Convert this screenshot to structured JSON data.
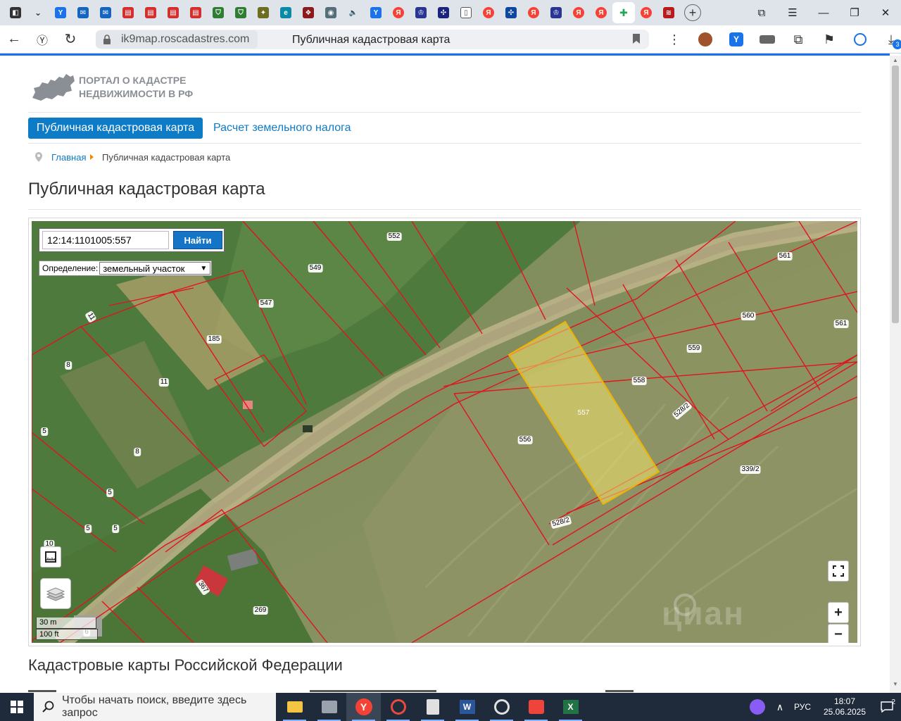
{
  "browser": {
    "url_host": "ik9map.roscadastres.com",
    "tab_title": "Публичная кадастровая карта",
    "download_badge": "3"
  },
  "site": {
    "logo_text_line1": "ПОРТАЛ О КАДАСТРЕ",
    "logo_text_line2": "НЕДВИЖИМОСТИ В РФ",
    "nav": {
      "active": "Публичная кадастровая карта",
      "link": "Расчет земельного налога"
    },
    "breadcrumb": {
      "home": "Главная",
      "current": "Публичная кадастровая карта"
    },
    "page_title": "Публичная кадастровая карта",
    "section_title": "Кадастровые карты Российской Федерации"
  },
  "map": {
    "search_value": "12:14:1101005:557",
    "search_button": "Найти",
    "definition_label": "Определение:",
    "definition_value": "земельный участок",
    "scale_metric": "30 m",
    "scale_imperial": "100 ft",
    "watermark": "циан",
    "zoom_in": "+",
    "zoom_out": "−",
    "selected_parcel": "557",
    "parcel_labels": [
      {
        "id": "l552",
        "text": "552"
      },
      {
        "id": "l549",
        "text": "549"
      },
      {
        "id": "l547",
        "text": "547"
      },
      {
        "id": "l561a",
        "text": "561"
      },
      {
        "id": "l561b",
        "text": "561"
      },
      {
        "id": "l560",
        "text": "560"
      },
      {
        "id": "l559",
        "text": "559"
      },
      {
        "id": "l558",
        "text": "558"
      },
      {
        "id": "l557",
        "text": "557"
      },
      {
        "id": "l556",
        "text": "556"
      },
      {
        "id": "l528a",
        "text": "528/2"
      },
      {
        "id": "l528b",
        "text": "528/2"
      },
      {
        "id": "l339",
        "text": "339/2"
      },
      {
        "id": "l185",
        "text": "185"
      },
      {
        "id": "l11a",
        "text": "11"
      },
      {
        "id": "l11b",
        "text": "11"
      },
      {
        "id": "l8a",
        "text": "8"
      },
      {
        "id": "l8b",
        "text": "8"
      },
      {
        "id": "l5a",
        "text": "5"
      },
      {
        "id": "l5b",
        "text": "5"
      },
      {
        "id": "l5c",
        "text": "5"
      },
      {
        "id": "l5d",
        "text": "5"
      },
      {
        "id": "l10",
        "text": "10"
      },
      {
        "id": "l367",
        "text": "367"
      },
      {
        "id": "l269",
        "text": "269"
      },
      {
        "id": "l6",
        "text": "6"
      }
    ]
  },
  "taskbar": {
    "search_placeholder": "Чтобы начать поиск, введите здесь запрос",
    "lang": "РУС",
    "time": "18:07",
    "date": "25.06.2025",
    "notifications": "2"
  },
  "colors": {
    "accent": "#0d7bc6",
    "parcel_border": "#e0141e",
    "selected_fill": "#f4e46a",
    "selected_border": "#f0b400"
  }
}
